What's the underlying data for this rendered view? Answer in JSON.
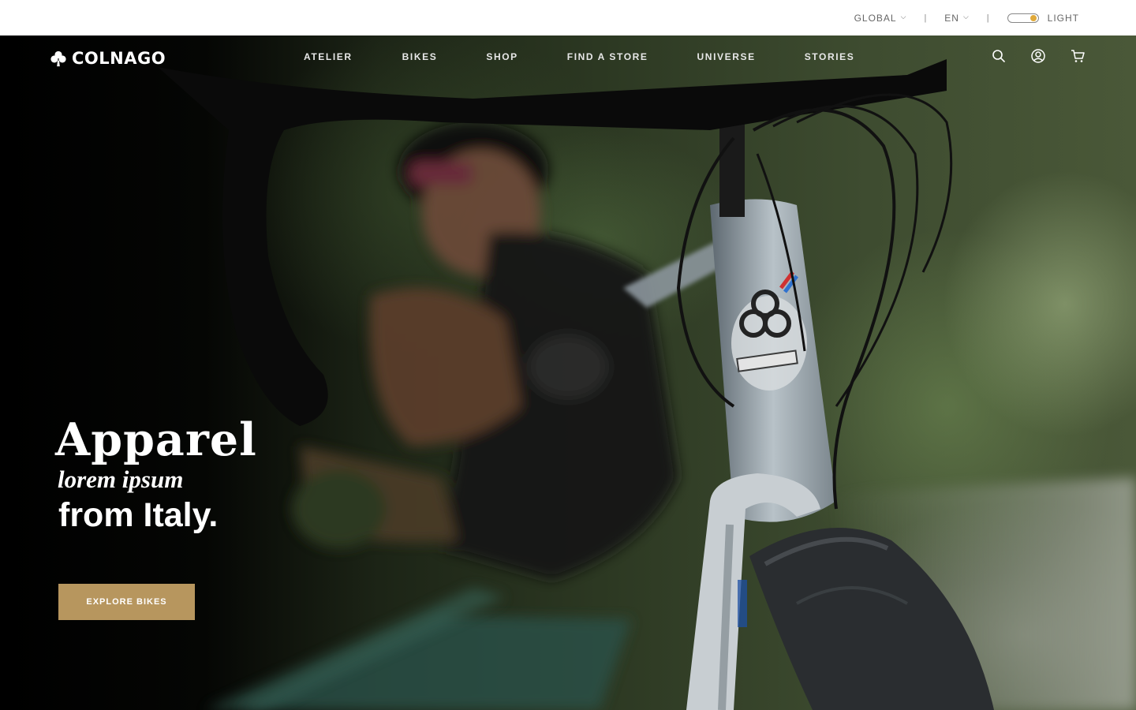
{
  "utility_bar": {
    "region_label": "GLOBAL",
    "language_label": "EN",
    "separator": "|",
    "theme_label": "LIGHT"
  },
  "nav": {
    "brand": "COLNAGO",
    "links": [
      "ATELIER",
      "BIKES",
      "SHOP",
      "FIND A STORE",
      "UNIVERSE",
      "STORIES"
    ],
    "icons": [
      "search-icon",
      "account-icon",
      "cart-icon"
    ]
  },
  "hero": {
    "headline_line1": "Apparel",
    "headline_line2": "lorem ipsum",
    "headline_line3": "from Italy.",
    "cta_label": "EXPLORE BIKES"
  },
  "colors": {
    "accent_gold": "#b7965e",
    "toggle_knob": "#e0a93a",
    "utility_bg": "#ffffff",
    "hero_dark": "#000000"
  }
}
